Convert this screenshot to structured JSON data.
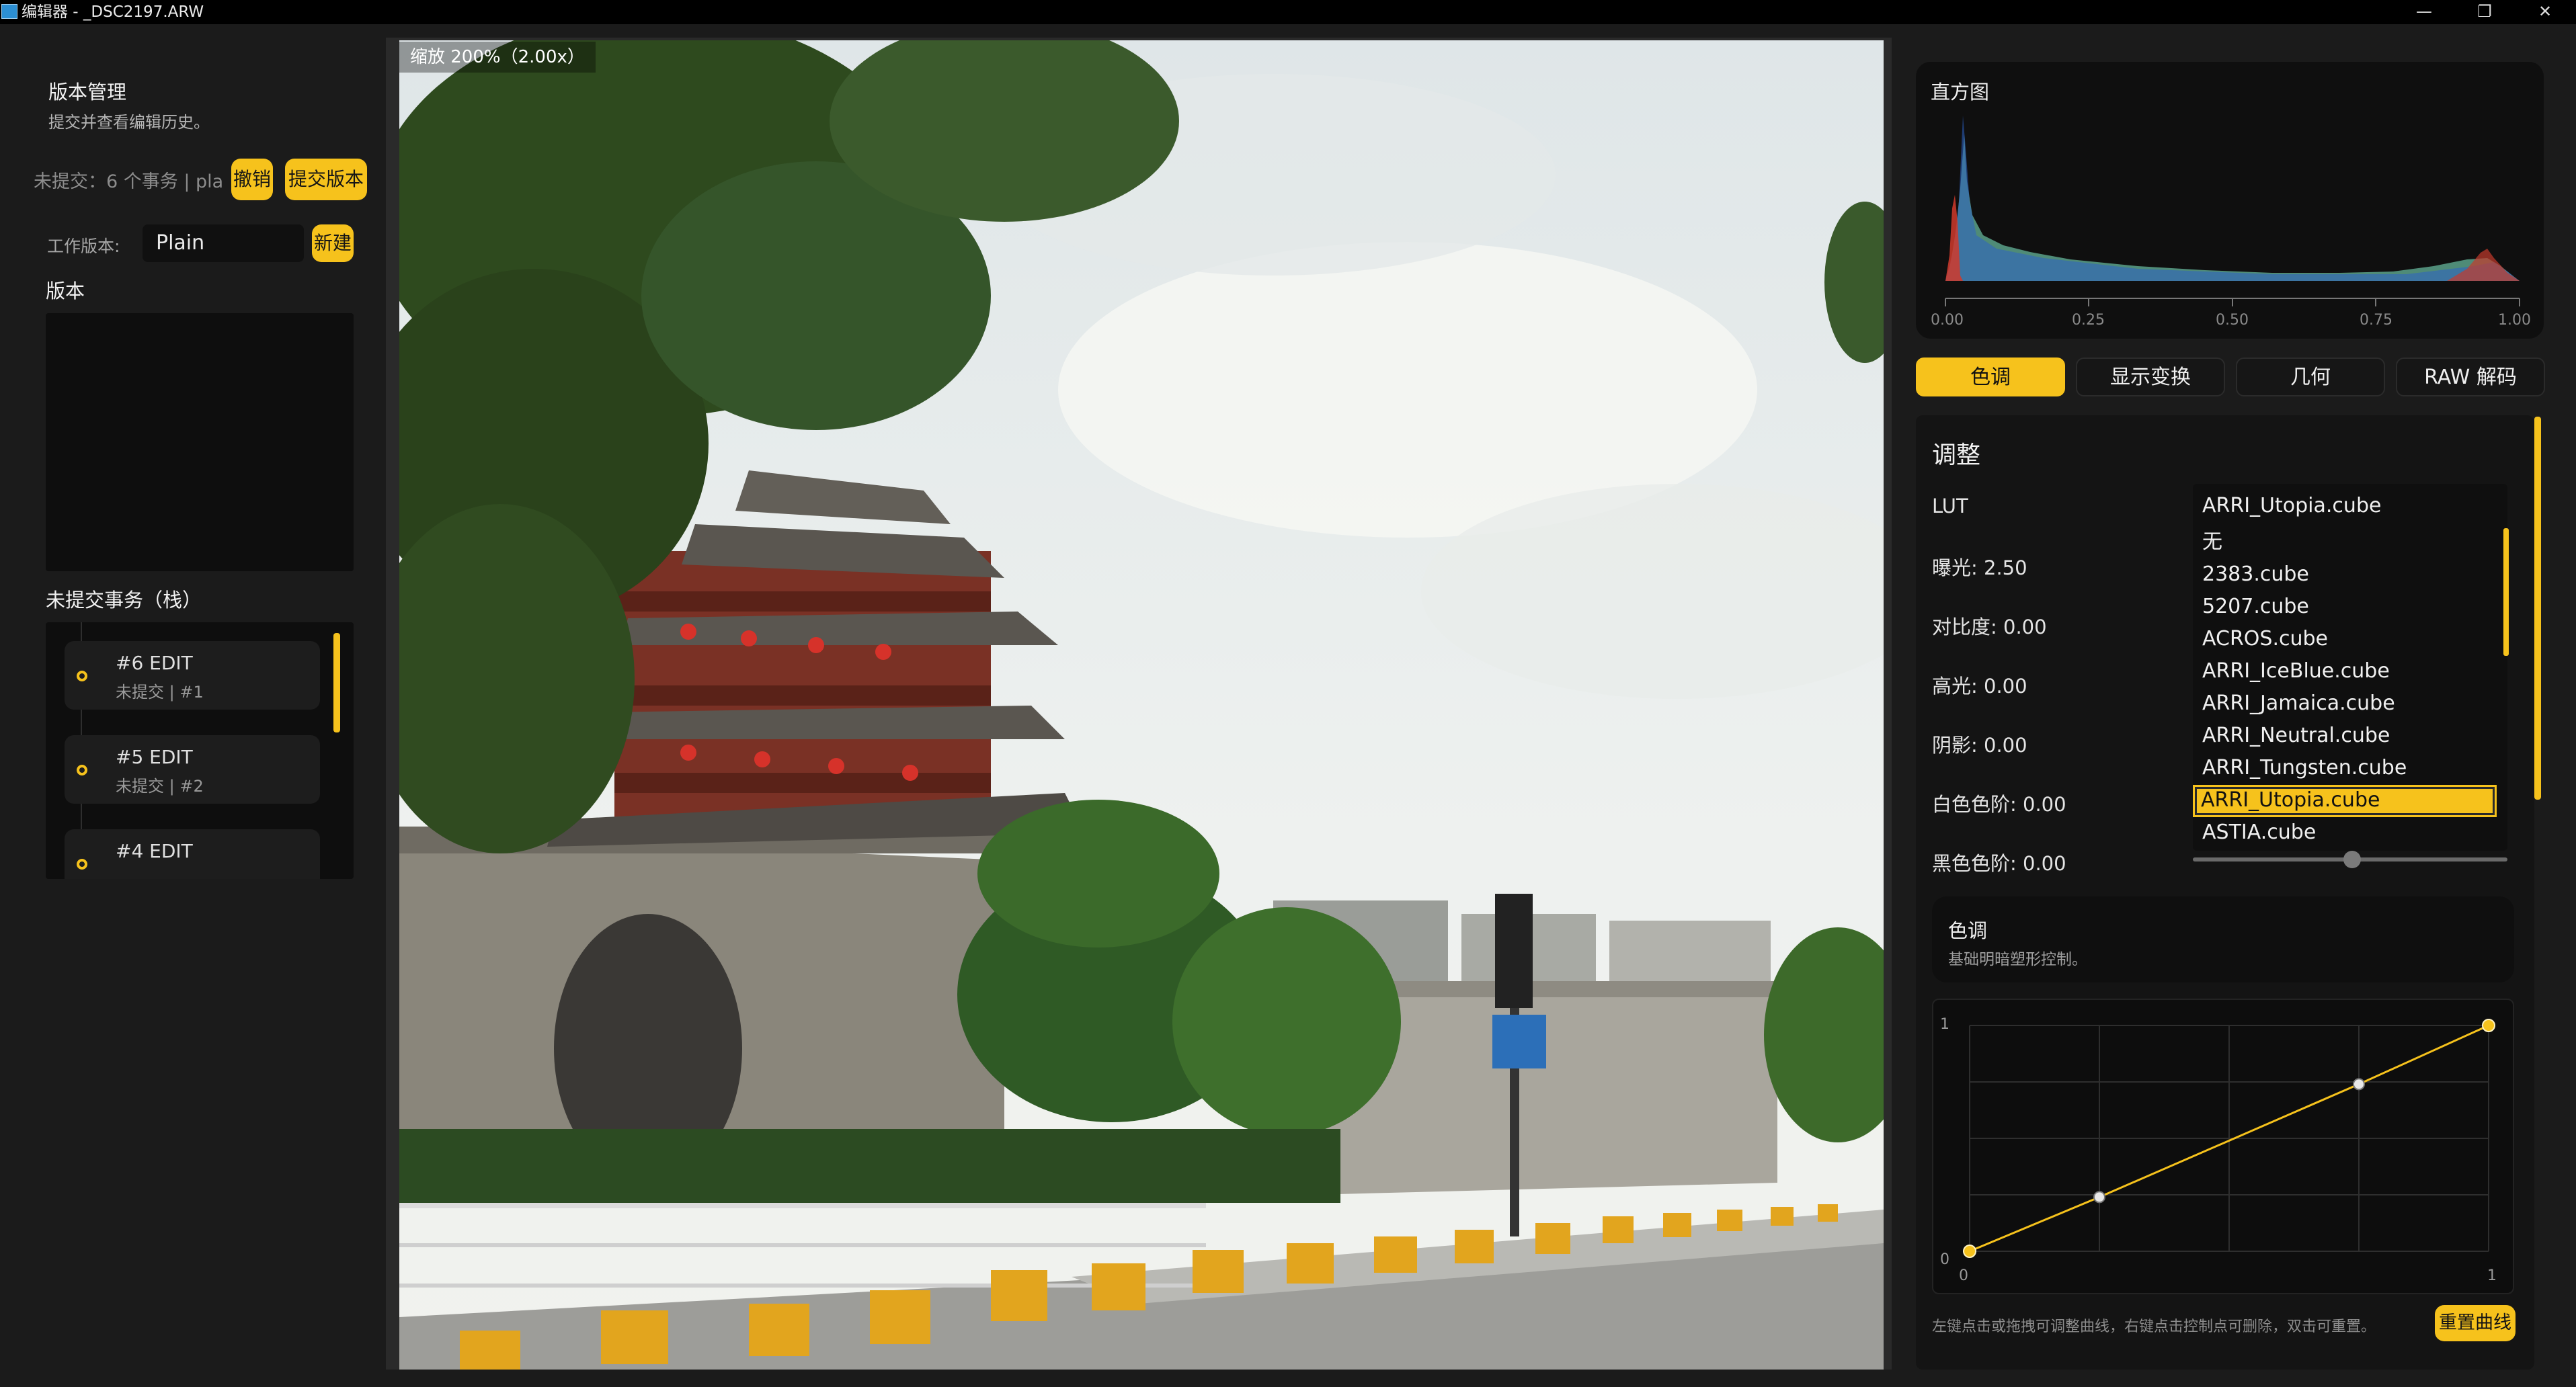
{
  "window": {
    "title": "编辑器 - _DSC2197.ARW",
    "controls": {
      "minimize": "—",
      "maximize": "❐",
      "close": "✕"
    }
  },
  "version_panel": {
    "title": "版本管理",
    "subtitle": "提交并查看编辑历史。",
    "uncommitted_status": "未提交：6 个事务 | pla",
    "undo_label": "撤销",
    "commit_label": "提交版本",
    "working_version_label": "工作版本:",
    "working_version_value": "Plain",
    "new_label": "新建",
    "versions_heading": "版本",
    "txn_heading": "未提交事务（栈）",
    "transactions": [
      {
        "title": "#6 EDIT",
        "meta": "未提交 | #1"
      },
      {
        "title": "#5 EDIT",
        "meta": "未提交 | #2"
      },
      {
        "title": "#4 EDIT",
        "meta": ""
      }
    ]
  },
  "viewer": {
    "zoom_label": "缩放 200%（2.00x）"
  },
  "histogram": {
    "title": "直方图",
    "ticks": [
      "0.00",
      "0.25",
      "0.50",
      "0.75",
      "1.00"
    ]
  },
  "tabs": [
    {
      "label": "色调",
      "active": true
    },
    {
      "label": "显示变换",
      "active": false
    },
    {
      "label": "几何",
      "active": false
    },
    {
      "label": "RAW 解码",
      "active": false
    }
  ],
  "adjust": {
    "title": "调整",
    "lut_label": "LUT",
    "lut_selected": "ARRI_Utopia.cube",
    "lut_options": [
      "无",
      "2383.cube",
      "5207.cube",
      "ACROS.cube",
      "ARRI_IceBlue.cube",
      "ARRI_Jamaica.cube",
      "ARRI_Neutral.cube",
      "ARRI_Tungsten.cube",
      "ARRI_Utopia.cube",
      "ASTIA.cube"
    ],
    "lut_highlighted_index": 8,
    "sliders": [
      {
        "label": "曝光: 2.50"
      },
      {
        "label": "对比度: 0.00"
      },
      {
        "label": "高光: 0.00"
      },
      {
        "label": "阴影: 0.00"
      },
      {
        "label": "白色色阶: 0.00"
      },
      {
        "label": "黑色色阶: 0.00",
        "level": 0.5
      }
    ]
  },
  "tone": {
    "title": "色调",
    "subtitle": "基础明暗塑形控制。"
  },
  "curve": {
    "y_max_label": "1",
    "y_min_label": "0",
    "x_min_label": "0",
    "x_max_label": "1",
    "points": [
      [
        0,
        0
      ],
      [
        0.25,
        0.24
      ],
      [
        0.75,
        0.74
      ],
      [
        1,
        1
      ]
    ],
    "hint": "左键点击或拖拽可调整曲线，右键点击控制点可删除，双击可重置。",
    "reset_label": "重置曲线"
  },
  "colors": {
    "accent": "#f6c21c",
    "panel_bg": "#1b1b1b",
    "card_bg": "#0f0f0f"
  }
}
